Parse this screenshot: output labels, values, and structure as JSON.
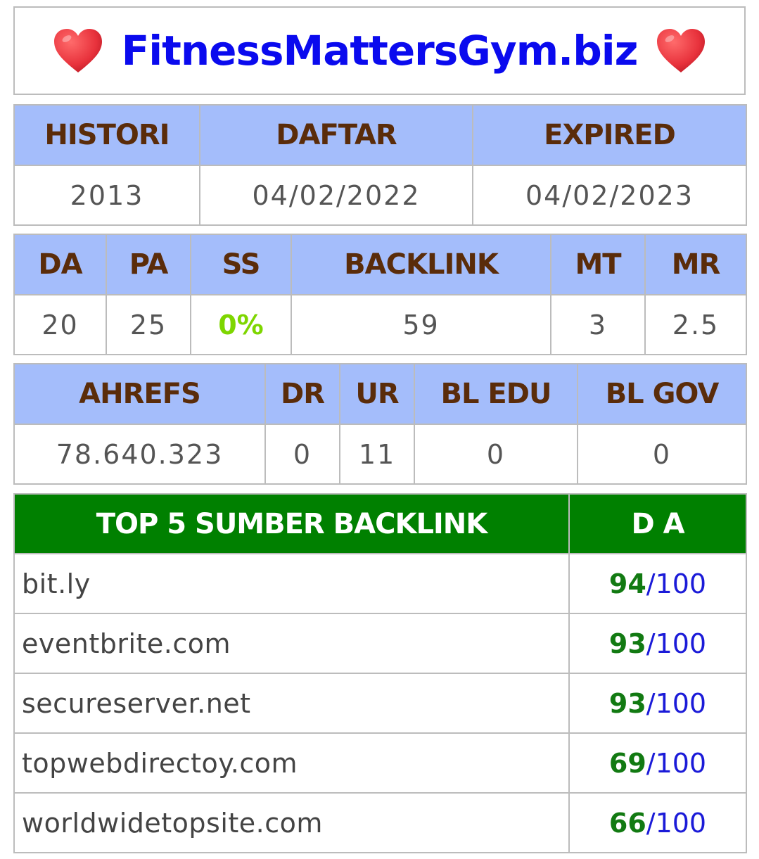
{
  "title": "FitnessMattersGym.biz",
  "colors": {
    "title": "#0a0aee",
    "header_bg": "#a4bdfb",
    "header_text": "#5a2c0a",
    "top5_header_bg": "#008000",
    "ss_value": "#7ed600",
    "da_score": "#127a12",
    "da_max": "#1b1bd8",
    "heart": "#e8323c"
  },
  "icons": {
    "left": "heart-icon",
    "right": "heart-icon"
  },
  "history_table": {
    "headers": [
      "HISTORI",
      "DAFTAR",
      "EXPIRED"
    ],
    "values": [
      "2013",
      "04/02/2022",
      "04/02/2023"
    ]
  },
  "metrics_table": {
    "headers": [
      "DA",
      "PA",
      "SS",
      "BACKLINK",
      "MT",
      "MR"
    ],
    "values": [
      "20",
      "25",
      "0%",
      "59",
      "3",
      "2.5"
    ]
  },
  "ahrefs_table": {
    "headers": [
      "AHREFS",
      "DR",
      "UR",
      "BL EDU",
      "BL GOV"
    ],
    "values": [
      "78.640.323",
      "0",
      "11",
      "0",
      "0"
    ]
  },
  "top5_table": {
    "headers": [
      "TOP 5 SUMBER BACKLINK",
      "D A"
    ],
    "slash": "/",
    "max": "100",
    "rows": [
      {
        "site": "bit.ly",
        "da": "94"
      },
      {
        "site": "eventbrite.com",
        "da": "93"
      },
      {
        "site": "secureserver.net",
        "da": "93"
      },
      {
        "site": "topwebdirectoy.com",
        "da": "69"
      },
      {
        "site": "worldwidetopsite.com",
        "da": "66"
      }
    ]
  }
}
